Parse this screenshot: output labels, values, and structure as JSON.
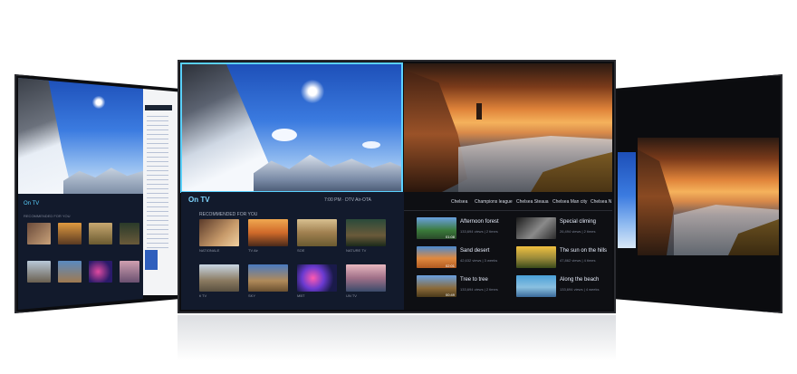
{
  "center": {
    "on_tv": "On TV",
    "channel_info": "7:00 PM · DTV Air-OTA",
    "recommended": "RECOMMENDED FOR YOU",
    "thumbs_row1": [
      "NATIONALE",
      "TV Air",
      "SOE",
      "NATURE TV"
    ],
    "thumbs_row2": [
      "ti TV",
      "SKY",
      "MBT",
      "UN TV"
    ],
    "categories": [
      "Chelsea",
      "Champions league",
      "Chelsea Steaua",
      "Chelsea Man city",
      "Chelsea N"
    ],
    "videos": [
      {
        "title": "Afternoon forest",
        "meta": "133,694 views | 2 times",
        "duration": "01:08"
      },
      {
        "title": "Special climing",
        "meta": "26,494 views | 2 times",
        "duration": ""
      },
      {
        "title": "Sand desert",
        "meta": "42,632 views | 3 weeks",
        "duration": "02:01"
      },
      {
        "title": "The sun on the hills",
        "meta": "47,862 views | 4 times",
        "duration": ""
      },
      {
        "title": "Tree to tree",
        "meta": "133,694 views | 2 times",
        "duration": "00:49"
      },
      {
        "title": "Along the beach",
        "meta": "133,694 views | 4 weeks",
        "duration": ""
      }
    ]
  },
  "left": {
    "on_tv": "On TV",
    "recommended": "RECOMMENDED FOR YOU"
  },
  "colors": {
    "focus": "#5ad1ff",
    "panel_bg": "#121a2c",
    "bezel": "#0c0d10"
  }
}
